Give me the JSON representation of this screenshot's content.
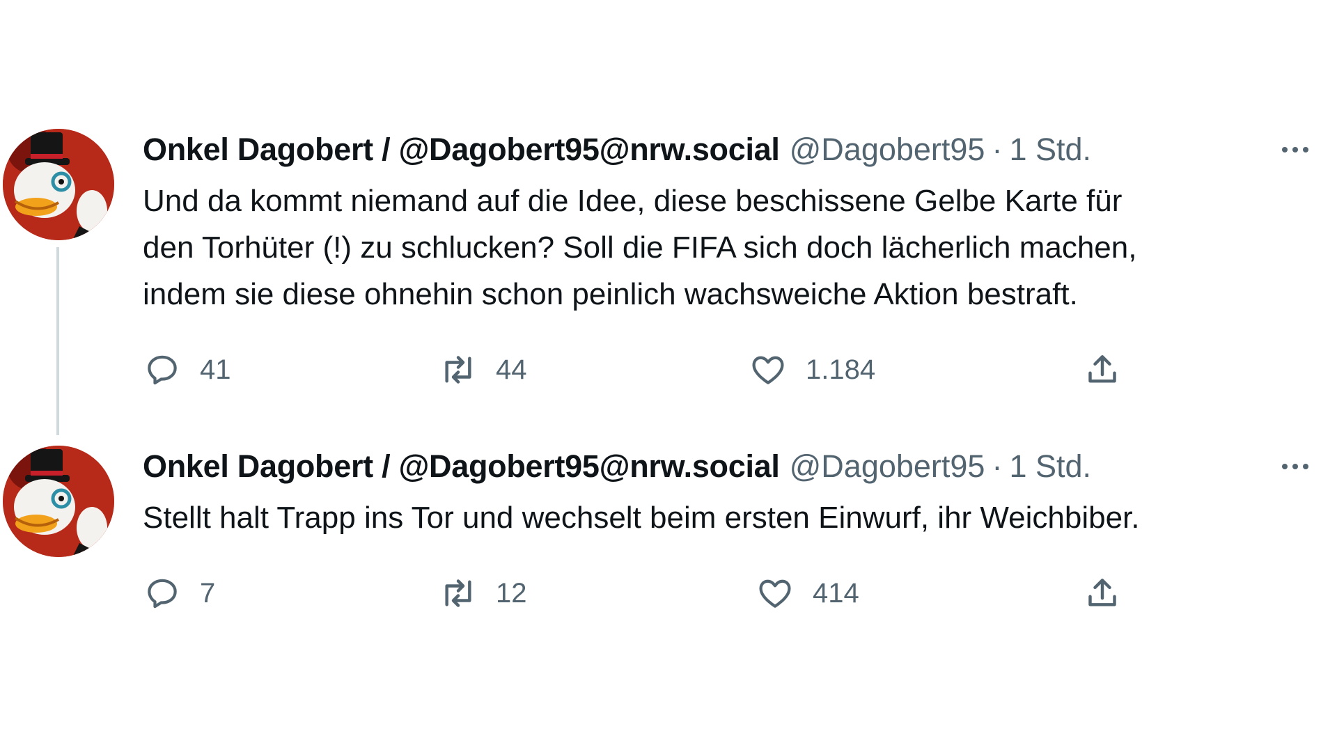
{
  "tweets": [
    {
      "display_name": "Onkel Dagobert / @Dagobert95@nrw.social",
      "handle": "@Dagobert95",
      "separator": "·",
      "time": "1 Std.",
      "text_lines": [
        "Und da kommt niemand auf die Idee, diese beschissene Gelbe Karte für",
        "den Torhüter (!) zu schlucken? Soll die FIFA sich doch lächerlich machen,",
        "indem sie diese ohnehin schon peinlich wachsweiche Aktion bestraft."
      ],
      "replies": "41",
      "retweets": "44",
      "likes": "1.184"
    },
    {
      "display_name": "Onkel Dagobert / @Dagobert95@nrw.social",
      "handle": "@Dagobert95",
      "separator": "·",
      "time": "1 Std.",
      "text_lines": [
        "Stellt halt Trapp ins Tor und wechselt beim ersten Einwurf, ihr Weichbiber."
      ],
      "replies": "7",
      "retweets": "12",
      "likes": "414"
    }
  ],
  "icons": {
    "reply": "reply-icon",
    "retweet": "retweet-icon",
    "like": "like-icon",
    "share": "share-icon",
    "more": "more-icon"
  },
  "colors": {
    "text": "#0f1419",
    "secondary": "#536471",
    "thread_line": "#cfd9de",
    "avatar_background": "#b72a1a"
  }
}
